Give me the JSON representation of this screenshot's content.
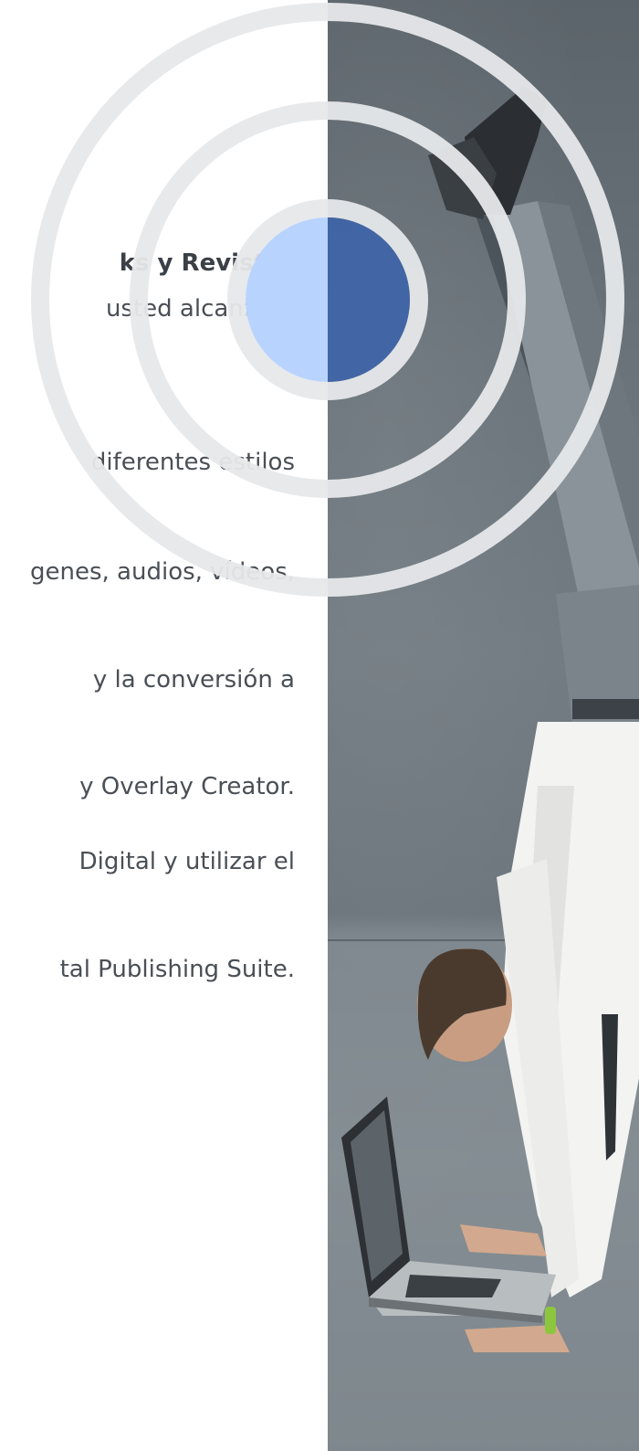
{
  "content": {
    "lines": [
      "ks y Revistas",
      "usted alcanzará",
      "diferentes estilos",
      "genes, audios, vídeos,",
      "y la conversión a",
      "y Overlay Creator.",
      "Digital y utilizar el",
      "tal Publishing Suite."
    ]
  },
  "colors": {
    "text": "#4a4f56",
    "ring": "#e6e8ea",
    "dot_light": "#b9d3ff",
    "dot_dark": "#3e64a8"
  },
  "image": {
    "description_icon": "handstand-businessman-laptop-photo"
  }
}
